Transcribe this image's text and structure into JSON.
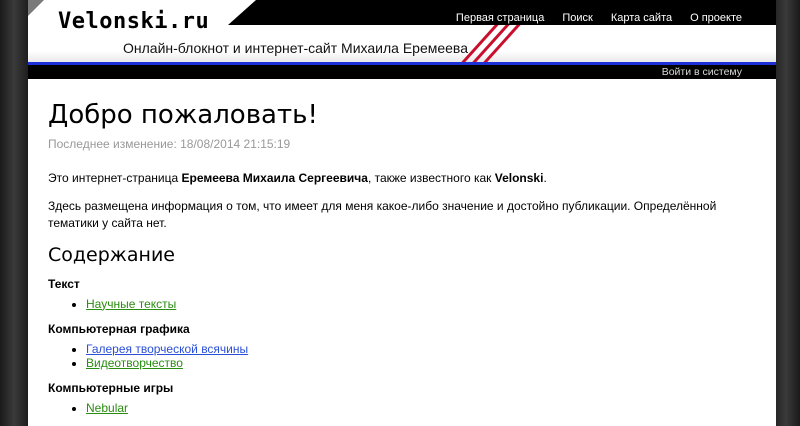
{
  "site": {
    "logo": "Velonski.ru",
    "tagline": "Онлайн-блокнот и интернет-сайт Михаила Еремеева"
  },
  "nav": {
    "items": [
      {
        "label": "Первая страница"
      },
      {
        "label": "Поиск"
      },
      {
        "label": "Карта сайта"
      },
      {
        "label": "О проекте"
      }
    ]
  },
  "userbar": {
    "login": "Войти в систему"
  },
  "main": {
    "title": "Добро пожаловать!",
    "modified": "Последнее изменение: 18/08/2014 21:15:19",
    "intro": {
      "before": "Это интернет-страница ",
      "name": "Еремеева Михаила Сергеевича",
      "middle": ", также известного как ",
      "nick": "Velonski",
      "after": "."
    },
    "description": "Здесь размещена информация о том, что имеет для меня какое-либо значение и достойно публикации. Определённой тематики у сайта нет.",
    "contents_heading": "Содержание",
    "sections": [
      {
        "title": "Текст",
        "links": [
          {
            "label": "Научные тексты"
          }
        ]
      },
      {
        "title": "Компьютерная графика",
        "links": [
          {
            "label": "Галерея творческой всячины"
          },
          {
            "label": "Видеотворчество"
          }
        ]
      },
      {
        "title": "Компьютерные игры",
        "links": [
          {
            "label": "Nebular"
          }
        ]
      }
    ]
  },
  "colors": {
    "header_bg": "#000000",
    "accent_stripes": "#c8102e",
    "blue_line": "#1d2fd6",
    "link_green": "#2a8c10",
    "link_blue": "#2a4fd8",
    "muted_text": "#999999"
  }
}
